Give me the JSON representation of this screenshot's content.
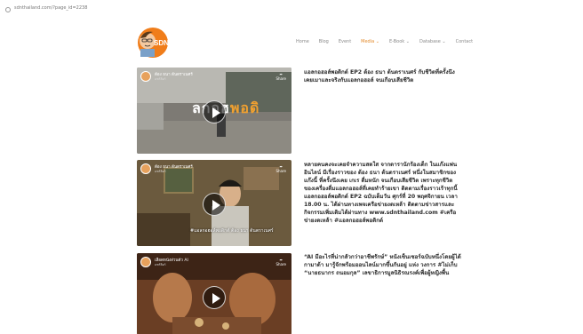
{
  "browser": {
    "url": "sdnthailand.com/?page_id=2238"
  },
  "header": {
    "logo_text": "SDN",
    "nav": [
      "Home",
      "Blog",
      "Event",
      "Media ⌄",
      "E-Book ⌄",
      "Database ⌄",
      "Contact"
    ],
    "active_index": 3,
    "colors": {
      "accent": "#e38a2b",
      "nav_text": "#8a8a8a"
    }
  },
  "videos": [
    {
      "channel": "ต้อง ธนา ต้นตราเนศร์",
      "channel_sub": "แชร์ลิงก์",
      "share_label": "Share",
      "overlay_left": "ลกอฮ",
      "overlay_right": "พอดิ",
      "caption": "",
      "description": "แอลกอฮอล์พอดิกต์ EP2 ต้อง ธนา ต้นตราเนศร์ กับชีวิตที่ครั้งนึงเคยเมาและจริงกับแอลกอฮอล์ จนเกือบเสียชีวิต"
    },
    {
      "channel": "ต้อง ธนา ต้นตราเนศร์",
      "channel_sub": "แชร์ลิงก์",
      "share_label": "Share",
      "overlay_left": "",
      "overlay_right": "",
      "caption": "#แอลกอฮอล์พอดิกต์ ต้อง ธนา ต้นตราเนศร์",
      "description": "หลายคนคงจะเคยจำความสดใส จากดารานักร้องเด็ก ในแก๊งแฟนอินไลน์ มีเรื่องราวของ ต้อง ธนา ต้นตราเนศร์ หนึ่งในสมาชิกของแก๊งนี้ ที่ครั้งนึงเคย เกเร ดื่มหนัก จนเกือบเสียชีวิต เพราะทุกชีวิตของเครื่องดื่มแอลกอฮอล์ที่เคยทำร้ายเขา ติดตามเรื่องราวเร้าทุกนี้ แอลกอฮอล์พอดิกต์ EP2 ฉบับเต็มวัน ศุกร์ที่ 20 พฤศจิกายน เวลา 18.00 น. ได้ผ่านทางเพจเครือข่ายงดเหล้า ติดตามข่าวสารและกิจกรรมเพิ่มเติมได้ผ่านทาง www.sdnthailand.com #เครือข่ายงดเหล้า #แอลกอฮอล์พอดิกต์"
    },
    {
      "channel": "เลือดหนังส่วนตัว AI",
      "channel_sub": "แชร์ลิงก์",
      "share_label": "Share",
      "overlay_left": "",
      "overlay_right": "",
      "caption": "",
      "description": "“AI มีอะไรที่น่ากลัวกว่าอาชีพรักษ์” หนังเซ็นเซอร์ฉบับหนึ่งโดยผู้ได้กามาด้า มารู้จักพร้อมออนไลน์มากขึ้นกันอยู่ แห่ง วงการ #ไม่เก็บ “นายธนากร ถนอมกุล” เลขาธิการมูลนิธิรณรงค์เพื่อผู้หญิงพื้น"
    }
  ]
}
